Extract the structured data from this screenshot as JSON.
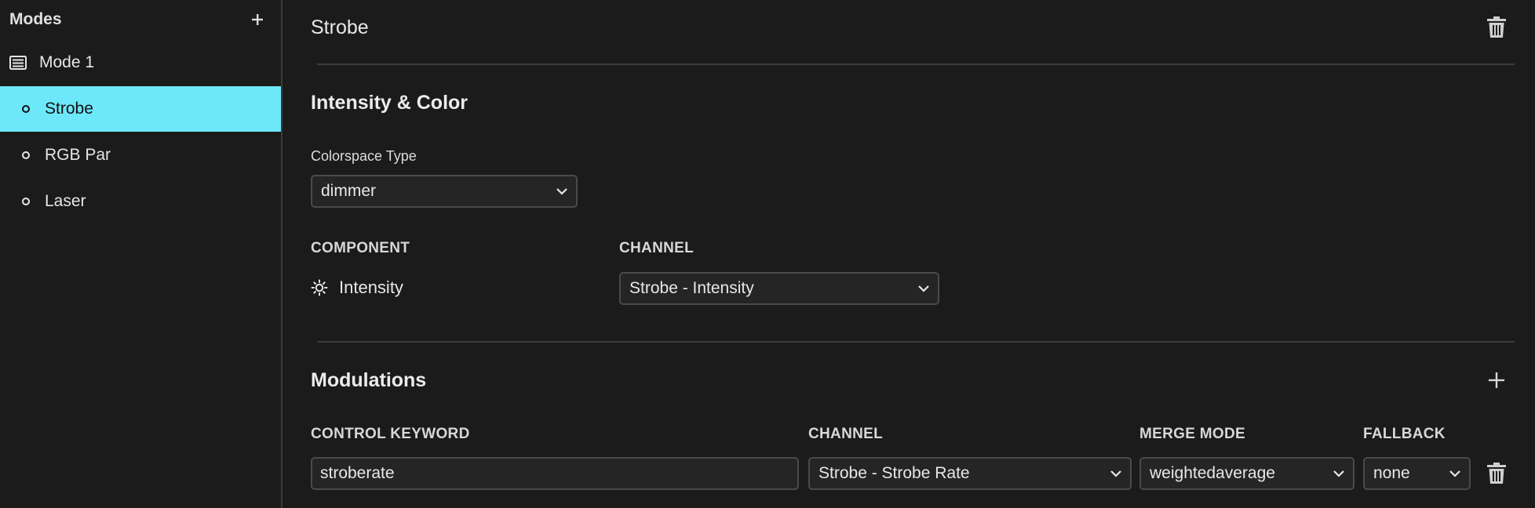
{
  "sidebar": {
    "title": "Modes",
    "mode": {
      "label": "Mode 1",
      "icon": "list-box-icon"
    },
    "fixtures": [
      {
        "label": "Strobe",
        "active": true
      },
      {
        "label": "RGB Par",
        "active": false
      },
      {
        "label": "Laser",
        "active": false
      }
    ]
  },
  "header": {
    "title": "Strobe"
  },
  "intensity": {
    "title": "Intensity & Color",
    "colorspace_label": "Colorspace Type",
    "colorspace_value": "dimmer",
    "component_head": "COMPONENT",
    "channel_head": "CHANNEL",
    "component": "Intensity",
    "component_channel": "Strobe - Intensity"
  },
  "modulations": {
    "title": "Modulations",
    "headers": {
      "keyword": "CONTROL KEYWORD",
      "channel": "CHANNEL",
      "merge": "MERGE MODE",
      "fallback": "FALLBACK"
    },
    "rows": [
      {
        "keyword": "stroberate",
        "channel": "Strobe - Strobe Rate",
        "merge": "weightedaverage",
        "fallback": "none"
      }
    ]
  },
  "colors": {
    "accent": "#6ce8fa",
    "background": "#1b1b1b"
  }
}
